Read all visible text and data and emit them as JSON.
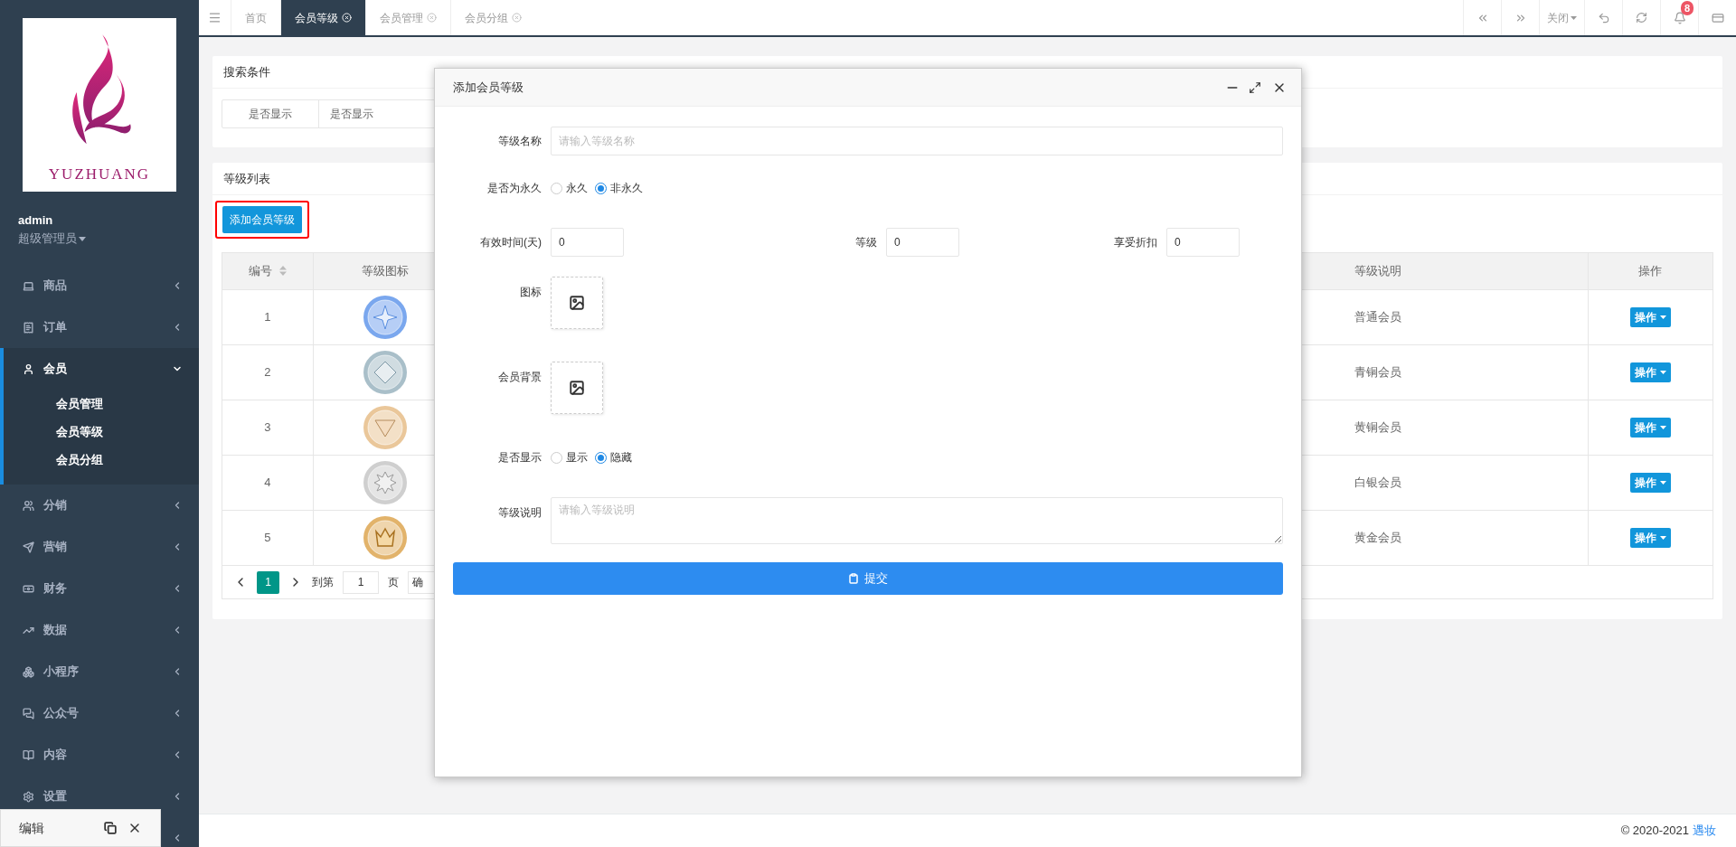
{
  "sidebar": {
    "logo_text": "YUZHUANG",
    "user": {
      "name": "admin",
      "role": "超级管理员"
    },
    "menu": [
      {
        "label": "商品",
        "expanded": false
      },
      {
        "label": "订单",
        "expanded": false
      },
      {
        "label": "会员",
        "expanded": true,
        "children": [
          {
            "label": "会员管理"
          },
          {
            "label": "会员等级"
          },
          {
            "label": "会员分组"
          }
        ]
      },
      {
        "label": "分销",
        "expanded": false
      },
      {
        "label": "营销",
        "expanded": false
      },
      {
        "label": "财务",
        "expanded": false
      },
      {
        "label": "数据",
        "expanded": false
      },
      {
        "label": "小程序",
        "expanded": false
      },
      {
        "label": "公众号",
        "expanded": false
      },
      {
        "label": "内容",
        "expanded": false
      },
      {
        "label": "设置",
        "expanded": false
      }
    ],
    "popup": {
      "label": "编辑"
    }
  },
  "tabs": [
    {
      "label": "首页",
      "selected": false,
      "closable": false
    },
    {
      "label": "会员等级",
      "selected": true,
      "closable": true
    },
    {
      "label": "会员管理",
      "selected": false,
      "closable": true
    },
    {
      "label": "会员分组",
      "selected": false,
      "closable": true
    }
  ],
  "toolbar": {
    "close_label": "关闭",
    "notifications": "8"
  },
  "search_panel": {
    "title": "搜索条件",
    "filter": {
      "label": "是否显示",
      "value": "是否显示"
    }
  },
  "list_panel": {
    "title": "等级列表",
    "add_button": "添加会员等级",
    "table": {
      "columns": [
        "编号",
        "等级图标",
        "等级说明",
        "操作"
      ],
      "rows": [
        {
          "id": "1",
          "color": "#7aa7ee",
          "kind": "star",
          "description": "普通会员",
          "action": "操作"
        },
        {
          "id": "2",
          "color": "#a9bfc9",
          "kind": "diamond",
          "description": "青铜会员",
          "action": "操作"
        },
        {
          "id": "3",
          "color": "#eac79a",
          "kind": "triangle",
          "description": "黄铜会员",
          "action": "操作"
        },
        {
          "id": "4",
          "color": "#cfcfcf",
          "kind": "burst",
          "description": "白银会员",
          "action": "操作"
        },
        {
          "id": "5",
          "color": "#e2b36b",
          "kind": "crown",
          "description": "黄金会员",
          "action": "操作"
        }
      ]
    },
    "pagination": {
      "current": "1",
      "goto_label": "到第",
      "page_value": "1",
      "page_suffix": "页",
      "confirm": "确"
    }
  },
  "dialog": {
    "title": "添加会员等级",
    "fields": [
      {
        "kind": "text",
        "label": "等级名称",
        "placeholder": "请输入等级名称"
      },
      {
        "kind": "radio",
        "label": "是否为永久",
        "options": [
          {
            "label": "永久",
            "selected": false
          },
          {
            "label": "非永久",
            "selected": true
          }
        ]
      },
      {
        "kind": "numbers",
        "items": [
          {
            "label": "有效时间(天)",
            "value": "0"
          },
          {
            "label": "等级",
            "value": "0"
          },
          {
            "label": "享受折扣",
            "value": "0"
          }
        ]
      },
      {
        "kind": "upload",
        "label": "图标"
      },
      {
        "kind": "upload",
        "label": "会员背景"
      },
      {
        "kind": "radio",
        "label": "是否显示",
        "options": [
          {
            "label": "显示",
            "selected": false
          },
          {
            "label": "隐藏",
            "selected": true
          }
        ]
      },
      {
        "kind": "textarea",
        "label": "等级说明",
        "placeholder": "请输入等级说明"
      }
    ],
    "submit": "提交"
  },
  "footer": {
    "copyright": "© 2020-2021",
    "link": "遇妆"
  }
}
